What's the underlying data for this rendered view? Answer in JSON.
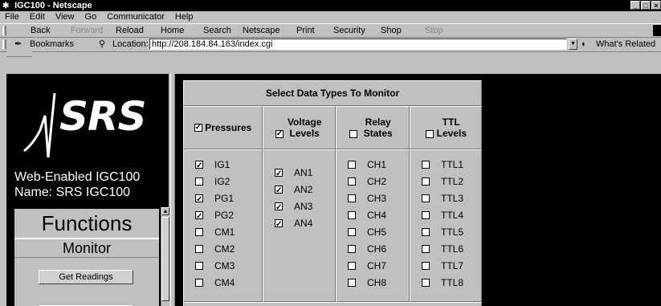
{
  "window": {
    "title": "IGC100 - Netscape",
    "controls": [
      "_",
      "□",
      "×"
    ]
  },
  "menu": [
    "File",
    "Edit",
    "View",
    "Go",
    "Communicator",
    "Help"
  ],
  "nav": [
    {
      "label": "Back",
      "enabled": true
    },
    {
      "label": "Forward",
      "enabled": false
    },
    {
      "label": "Reload",
      "enabled": true
    },
    {
      "label": "Home",
      "enabled": true
    },
    {
      "label": "Search",
      "enabled": true
    },
    {
      "label": "Netscape",
      "enabled": true
    },
    {
      "label": "Print",
      "enabled": true
    },
    {
      "label": "Security",
      "enabled": true
    },
    {
      "label": "Shop",
      "enabled": true
    },
    {
      "label": "Stop",
      "enabled": false
    }
  ],
  "location": {
    "bookmarks_label": "Bookmarks",
    "location_label": "Location:",
    "url": "http://208.184.84.163/index.cgi",
    "related_label": "What's Related"
  },
  "sidebar": {
    "logo_text": "SRS",
    "line1": "Web-Enabled IGC100",
    "line2": "Name: SRS IGC100",
    "functions_title": "Functions",
    "monitor_label": "Monitor",
    "get_readings_label": "Get Readings"
  },
  "monitor_panel": {
    "title": "Select Data Types To Monitor",
    "columns": [
      {
        "header": "Pressures",
        "header_checked": true,
        "items": [
          {
            "label": "IG1",
            "checked": true
          },
          {
            "label": "IG2",
            "checked": false
          },
          {
            "label": "PG1",
            "checked": true
          },
          {
            "label": "PG2",
            "checked": true
          },
          {
            "label": "CM1",
            "checked": false
          },
          {
            "label": "CM2",
            "checked": false
          },
          {
            "label": "CM3",
            "checked": false
          },
          {
            "label": "CM4",
            "checked": false
          }
        ]
      },
      {
        "header": "Voltage Levels",
        "header_checked": true,
        "items": [
          {
            "label": "AN1",
            "checked": true
          },
          {
            "label": "AN2",
            "checked": true
          },
          {
            "label": "AN3",
            "checked": true
          },
          {
            "label": "AN4",
            "checked": true
          }
        ]
      },
      {
        "header": "Relay States",
        "header_checked": false,
        "items": [
          {
            "label": "CH1",
            "checked": false
          },
          {
            "label": "CH2",
            "checked": false
          },
          {
            "label": "CH3",
            "checked": false
          },
          {
            "label": "CH4",
            "checked": false
          },
          {
            "label": "CH5",
            "checked": false
          },
          {
            "label": "CH6",
            "checked": false
          },
          {
            "label": "CH7",
            "checked": false
          },
          {
            "label": "CH8",
            "checked": false
          }
        ]
      },
      {
        "header": "TTL Levels",
        "header_checked": false,
        "items": [
          {
            "label": "TTL1",
            "checked": false
          },
          {
            "label": "TTL2",
            "checked": false
          },
          {
            "label": "TTL3",
            "checked": false
          },
          {
            "label": "TTL4",
            "checked": false
          },
          {
            "label": "TTL5",
            "checked": false
          },
          {
            "label": "TTL6",
            "checked": false
          },
          {
            "label": "TTL7",
            "checked": false
          },
          {
            "label": "TTL8",
            "checked": false
          }
        ]
      }
    ]
  }
}
